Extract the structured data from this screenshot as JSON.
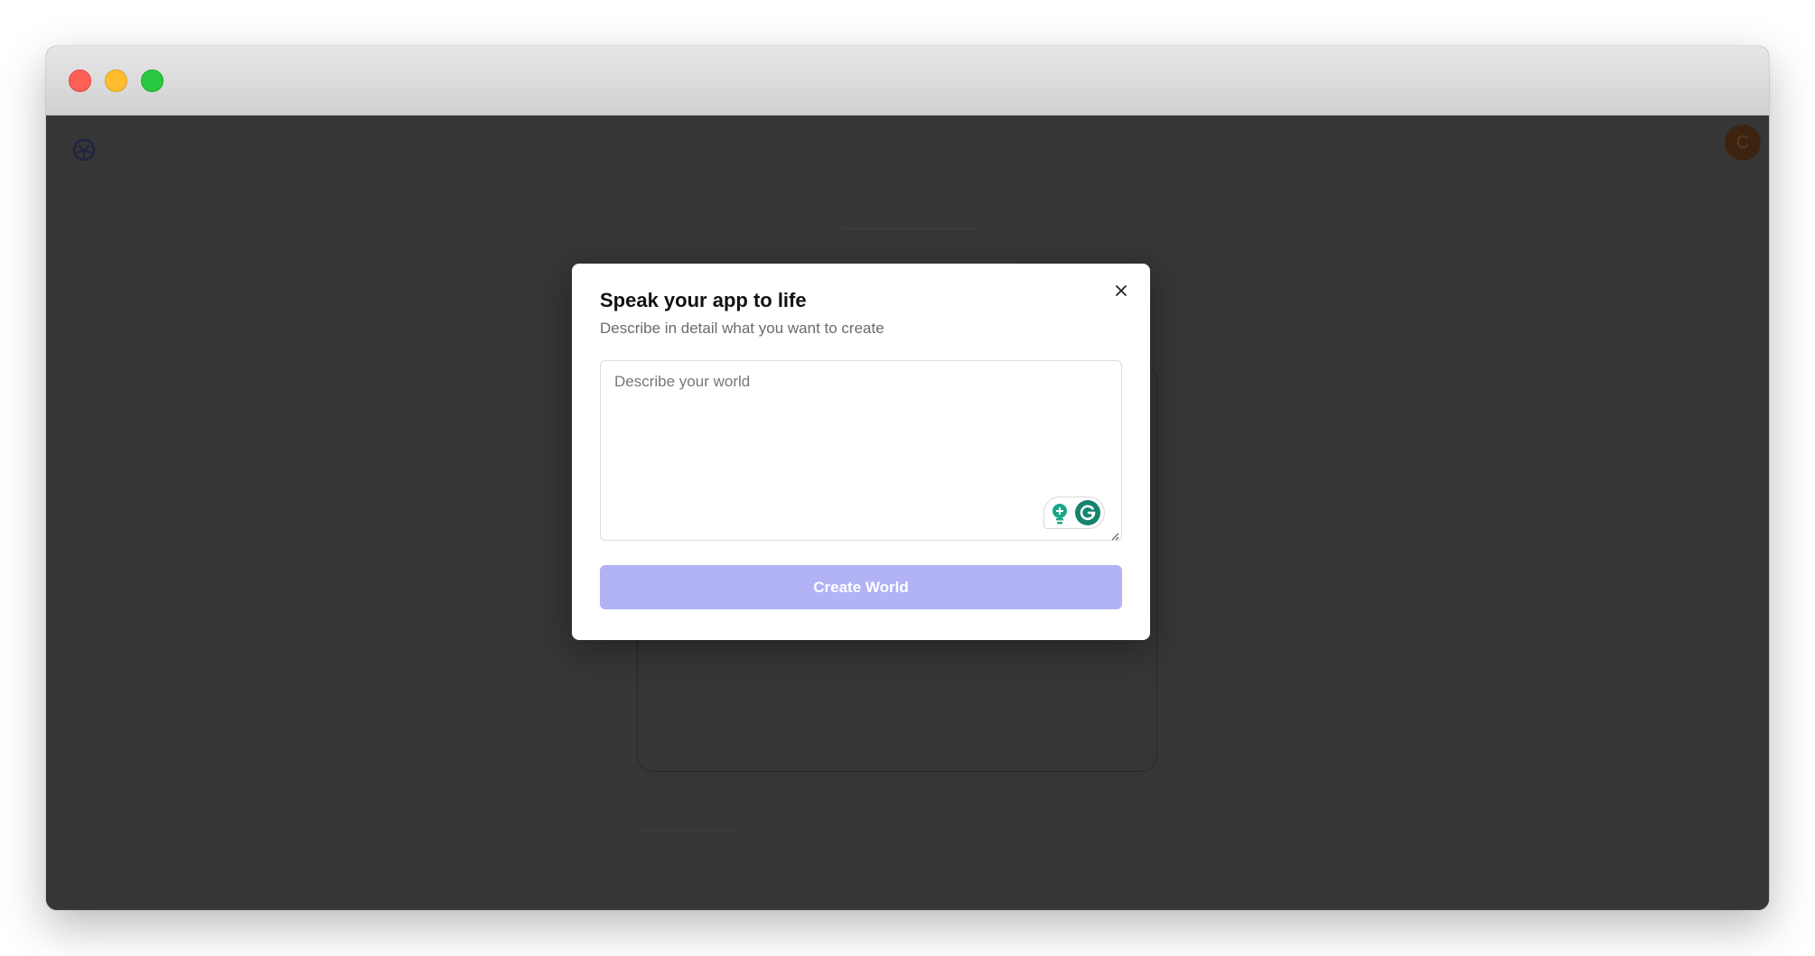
{
  "modal": {
    "title": "Speak your app to life",
    "subtitle": "Describe in detail what you want to create",
    "textarea": {
      "placeholder": "Describe your world",
      "value": ""
    },
    "primary_button": "Create World",
    "close_icon": "close-icon"
  },
  "header": {
    "logo_icon": "app-logo-icon",
    "avatar_initial": "C"
  },
  "colors": {
    "backdrop": "#363636",
    "button_disabled": "#b1b3f5",
    "grammar_green": "#15846d"
  }
}
